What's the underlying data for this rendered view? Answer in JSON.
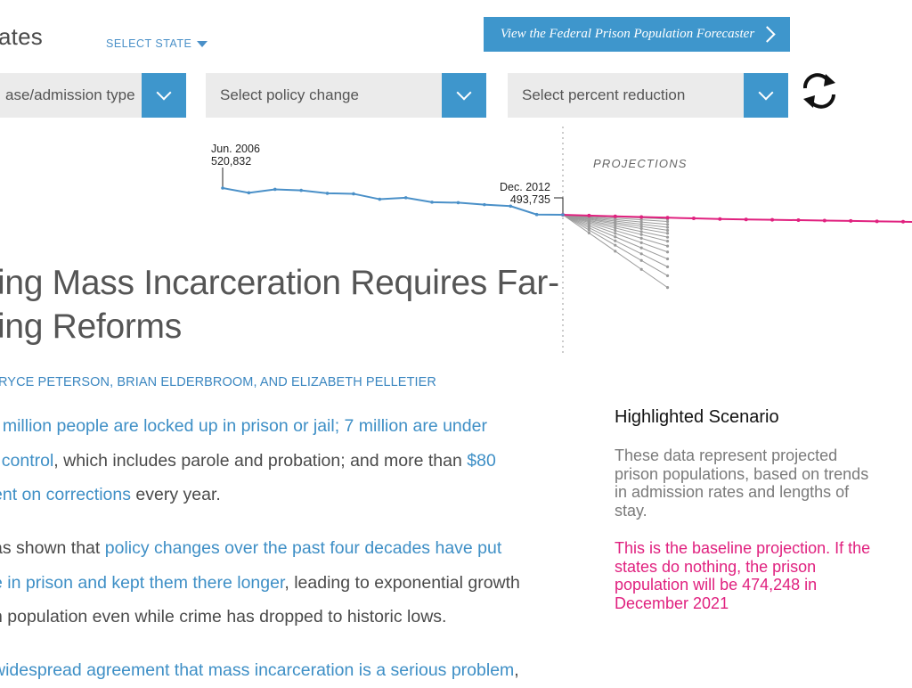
{
  "header": {
    "states_title": "ates",
    "select_state_label": "SELECT STATE",
    "forecaster_button": "View the Federal Prison Population Forecaster"
  },
  "dropdowns": {
    "type": "ase/admission type",
    "policy": "Select policy change",
    "percent": "Select percent reduction"
  },
  "chart_data": {
    "type": "line",
    "start_annotation": {
      "date": "Jun. 2006",
      "value": "520,832"
    },
    "end_annotation": {
      "date": "Dec. 2012",
      "value": "493,735"
    },
    "projections_label": "PROJECTIONS",
    "colors": {
      "historical": "#4a90c8",
      "baseline": "#e0217f",
      "scenarios": "#9b9b9b"
    },
    "historical": {
      "x": [
        "2006-06",
        "2006-12",
        "2007-06",
        "2007-12",
        "2008-06",
        "2008-12",
        "2009-06",
        "2009-12",
        "2010-06",
        "2010-12",
        "2011-06",
        "2011-12",
        "2012-06",
        "2012-12"
      ],
      "y": [
        520832,
        516000,
        519500,
        518500,
        515500,
        515000,
        509500,
        511000,
        506500,
        506000,
        504000,
        502500,
        494000,
        493735
      ]
    },
    "baseline_projection": {
      "x": [
        "2012-12",
        "2013-06",
        "2013-12",
        "2014-06",
        "2014-12",
        "2015-06",
        "2015-12",
        "2016-06",
        "2016-12",
        "2017-06",
        "2017-12",
        "2018-06",
        "2018-12",
        "2019-06",
        "2019-12",
        "2020-06",
        "2020-12",
        "2021-06",
        "2021-12"
      ],
      "y": [
        493735,
        492900,
        492200,
        491500,
        490800,
        490100,
        489500,
        489000,
        488600,
        488300,
        487900,
        487500,
        487100,
        486700,
        486300,
        485900,
        485500,
        485100,
        484700
      ]
    },
    "scenario_final_2014_12": [
      491000,
      489500,
      487000,
      484000,
      481000,
      478000,
      475000,
      471000,
      467000,
      462000,
      456000,
      449000,
      441000,
      432000,
      420000
    ],
    "x_range_start": "2006-06",
    "grid": false
  },
  "article": {
    "headline_line1": "ing Mass Incarceration Requires Far-",
    "headline_line2": "ing Reforms",
    "authors": "RYCE PETERSON, BRIAN ELDERBROOM, AND ELIZABETH PELLETIER",
    "p1_l1_link": "t million people are locked up in prison or jail; 7 million are under",
    "p1_l2_link1": "l control",
    "p1_l2_text": ", which includes parole and probation; and more than ",
    "p1_l2_link2": "$80",
    "p1_l3_link": "ent on corrections",
    "p1_l3_text": " every year.",
    "p2_l1_text": "as shown that ",
    "p2_l1_link": "policy changes over the past four decades have put",
    "p2_l2_link": "e in prison and kept them there longer",
    "p2_l2_text": ", leading to exponential growth",
    "p2_l3_text": "n population even while crime has dropped to historic lows.",
    "p3_l1_link": "widespread agreement that mass incarceration is a serious problem",
    "p3_l1_text": ","
  },
  "sidebar": {
    "title": "Highlighted Scenario",
    "description": "These data represent projected prison populations, based on trends in admission rates and lengths of stay.",
    "highlight": "This is the baseline projection. If the states do nothing, the prison population will be 474,248 in December 2021"
  }
}
